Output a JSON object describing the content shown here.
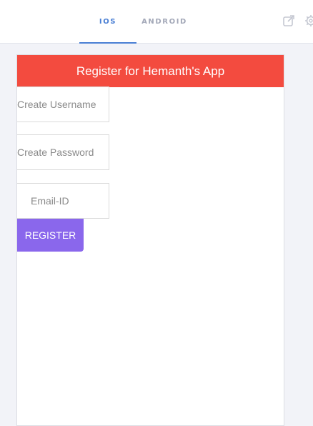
{
  "tabs": {
    "ios_label": "IOS",
    "android_label": "ANDROID",
    "active": "ios"
  },
  "icons": {
    "open_external": "external-link-icon",
    "settings": "gear-icon"
  },
  "colors": {
    "header_bg": "#f34b3f",
    "button_bg": "#8a67ec",
    "active_tab": "#4a7fd4"
  },
  "app": {
    "header_title": "Register for Hemanth's App",
    "username_placeholder": "Create Username",
    "password_placeholder": "Create Password",
    "email_placeholder": "Email-ID",
    "register_label": "REGISTER"
  }
}
